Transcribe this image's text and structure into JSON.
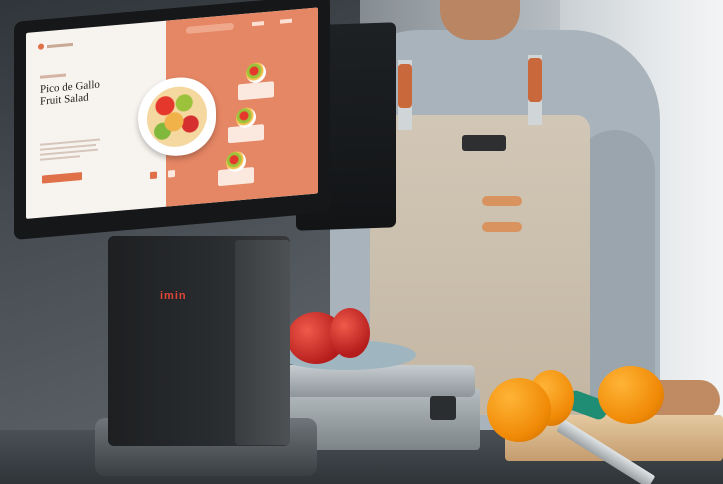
{
  "screen": {
    "title": "Pico de Gallo Fruit Salad"
  },
  "terminal": {
    "brand": "imin"
  }
}
